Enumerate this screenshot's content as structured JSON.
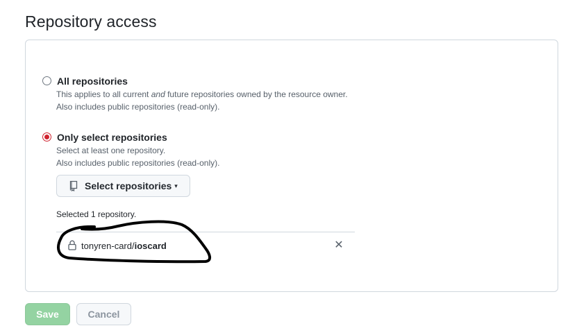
{
  "section": {
    "title": "Repository access"
  },
  "options": [
    {
      "label": "All repositories",
      "line1_pre": "This applies to all current ",
      "line1_em": "and",
      "line1_post": " future repositories owned by the resource owner.",
      "line2": "Also includes public repositories (read-only).",
      "selected": false
    },
    {
      "label": "Only select repositories",
      "line1": "Select at least one repository.",
      "line2": "Also includes public repositories (read-only).",
      "selected": true
    }
  ],
  "select_button": {
    "label": "Select repositories",
    "icon": "repo-icon",
    "caret": "▾"
  },
  "selected_summary": "Selected 1 repository.",
  "repos": [
    {
      "owner": "tonyren-card/",
      "name": "ioscard",
      "icon": "lock-icon",
      "remove": "✕"
    }
  ],
  "actions": {
    "save_label": "Save",
    "cancel_label": "Cancel"
  },
  "colors": {
    "accent": "#cf222e",
    "save_bg": "#94d3a2",
    "border": "#d0d7de",
    "muted": "#57606a"
  }
}
